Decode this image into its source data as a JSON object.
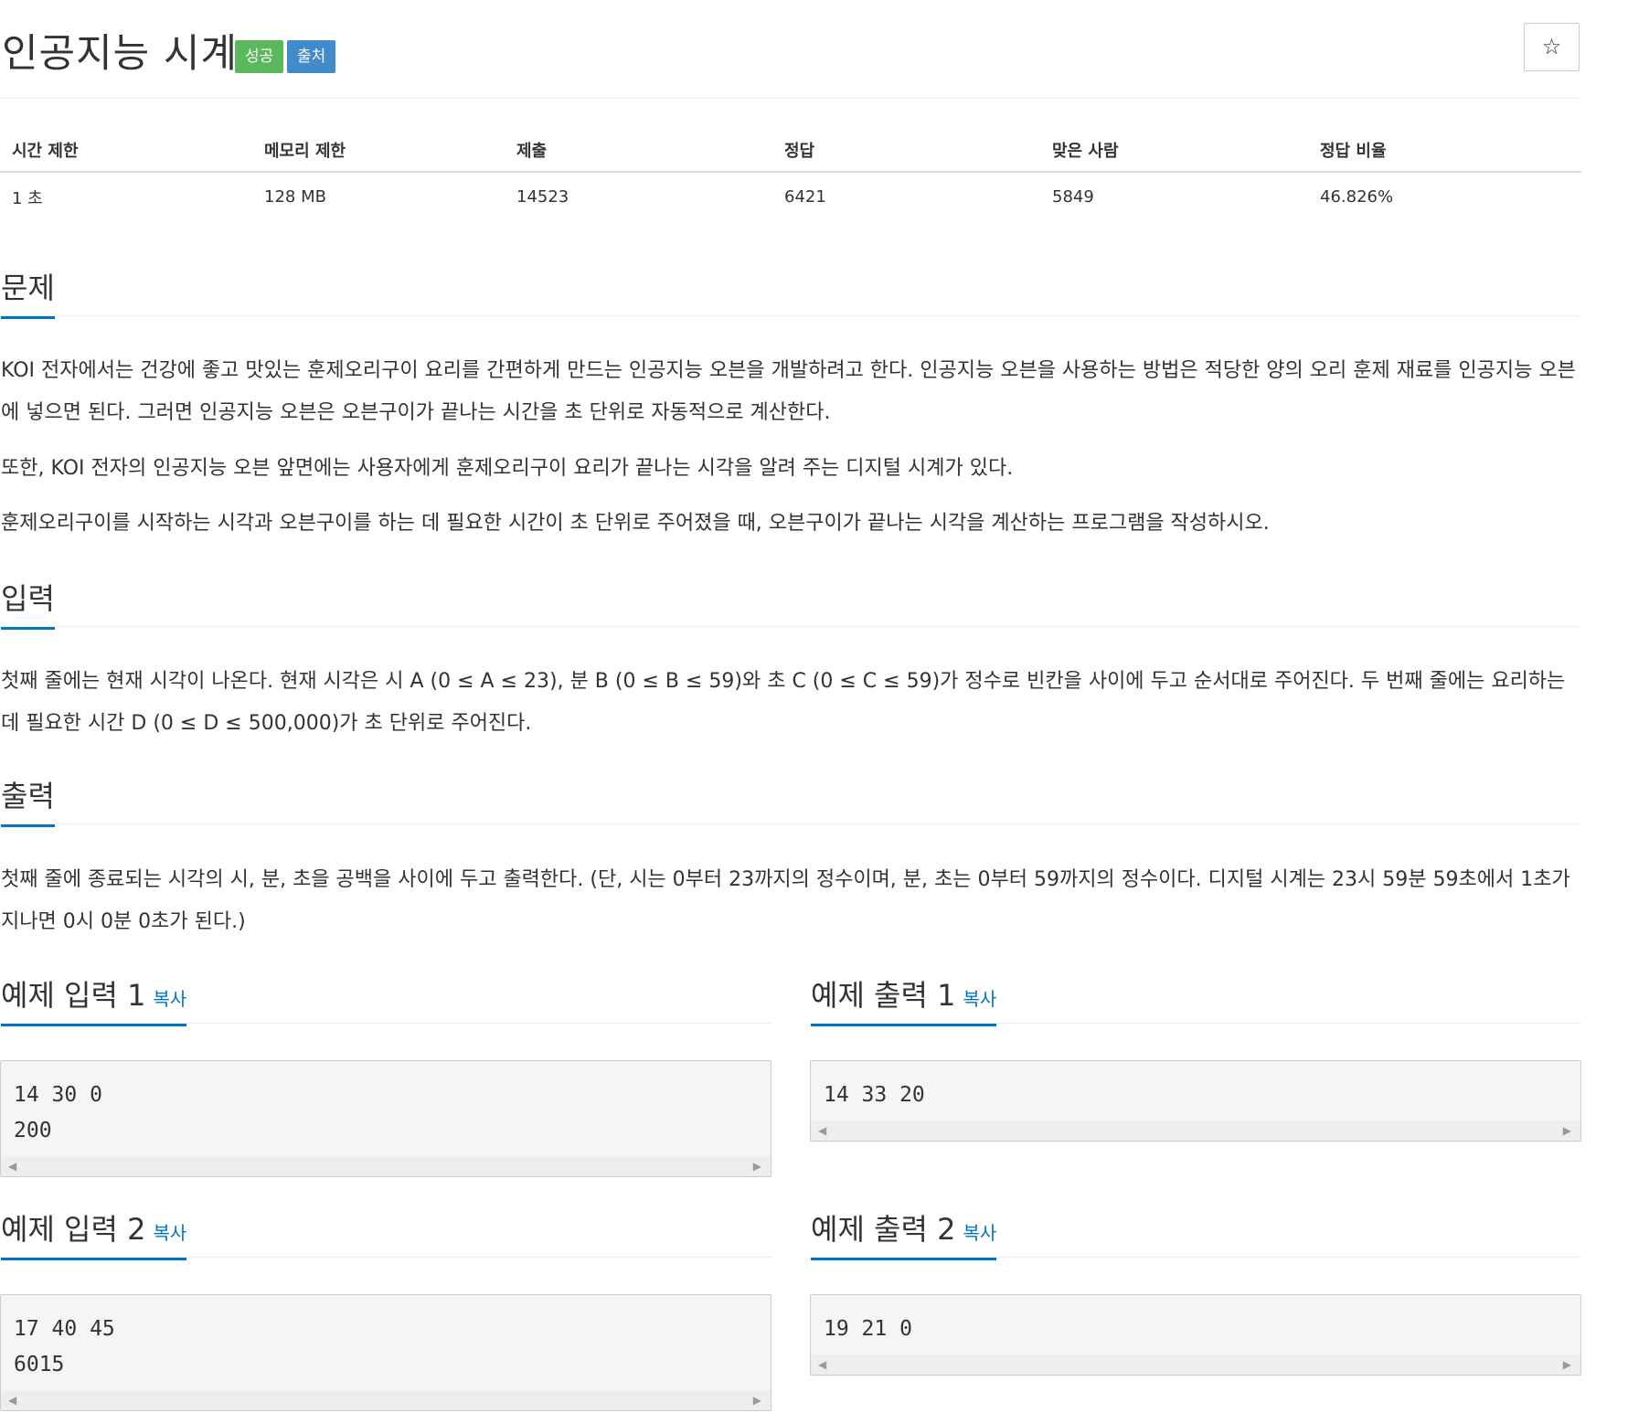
{
  "problem": {
    "title": "인공지능 시계",
    "labels": {
      "success": "성공",
      "source": "출처"
    },
    "star_icon": "☆"
  },
  "stats": {
    "headers": [
      "시간 제한",
      "메모리 제한",
      "제출",
      "정답",
      "맞은 사람",
      "정답 비율"
    ],
    "values": [
      "1 초",
      "128 MB",
      "14523",
      "6421",
      "5849",
      "46.826%"
    ]
  },
  "sections": {
    "problem": {
      "title": "문제",
      "paragraphs": [
        "KOI 전자에서는 건강에 좋고 맛있는 훈제오리구이 요리를 간편하게 만드는 인공지능 오븐을 개발하려고 한다. 인공지능 오븐을 사용하는 방법은 적당한 양의 오리 훈제 재료를 인공지능 오븐에 넣으면 된다. 그러면 인공지능 오븐은 오븐구이가 끝나는 시간을 초 단위로 자동적으로 계산한다.",
        "또한, KOI 전자의 인공지능 오븐 앞면에는 사용자에게 훈제오리구이 요리가 끝나는 시각을 알려 주는 디지털 시계가 있다.",
        "훈제오리구이를 시작하는 시각과 오븐구이를 하는 데 필요한 시간이 초 단위로 주어졌을 때, 오븐구이가 끝나는 시각을 계산하는 프로그램을 작성하시오."
      ]
    },
    "input": {
      "title": "입력",
      "paragraph": "첫째 줄에는 현재 시각이 나온다. 현재 시각은 시 A (0 ≤ A ≤ 23), 분 B (0 ≤ B ≤ 59)와 초 C (0 ≤ C ≤ 59)가 정수로 빈칸을 사이에 두고 순서대로 주어진다. 두 번째 줄에는 요리하는 데 필요한 시간 D (0 ≤ D ≤ 500,000)가 초 단위로 주어진다."
    },
    "output": {
      "title": "출력",
      "paragraph": "첫째 줄에 종료되는 시각의 시, 분, 초을 공백을 사이에 두고 출력한다. (단, 시는 0부터 23까지의 정수이며, 분, 초는 0부터 59까지의 정수이다. 디지털 시계는 23시 59분 59초에서 1초가 지나면 0시 0분 0초가 된다.)"
    }
  },
  "samples": {
    "copy_label": "복사",
    "input1": {
      "title": "예제 입력 1",
      "content": "14 30 0\n200"
    },
    "output1": {
      "title": "예제 출력 1",
      "content": "14 33 20"
    },
    "input2": {
      "title": "예제 입력 2",
      "content": "17 40 45\n6015"
    },
    "output2": {
      "title": "예제 출력 2",
      "content": "19 21 0"
    }
  }
}
